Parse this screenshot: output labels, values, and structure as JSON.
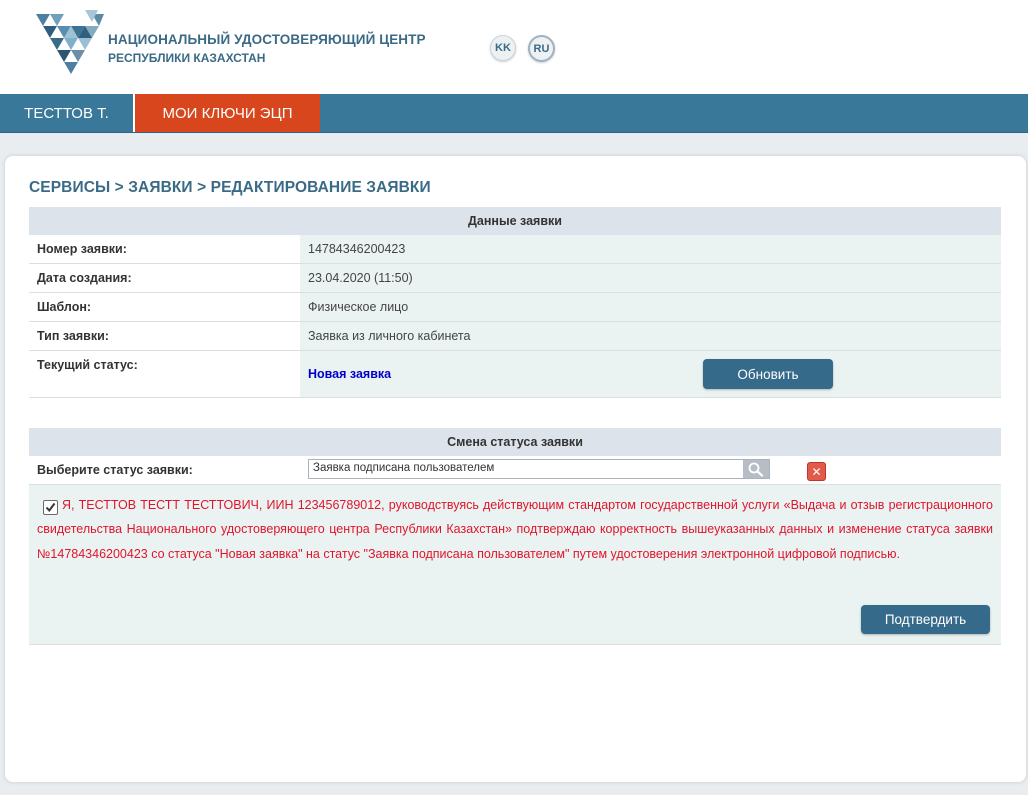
{
  "header": {
    "org_name": "НАЦИОНАЛЬНЫЙ УДОСТОВЕРЯЮЩИЙ ЦЕНТР",
    "org_sub": "РЕСПУБЛИКИ КАЗАХСТАН",
    "lang_kk": "KK",
    "lang_ru": "RU",
    "brand_color": "#3b6a86"
  },
  "nav": {
    "user_label": "ТЕСТТОВ Т.",
    "keys_label": "МОИ КЛЮЧИ ЭЦП",
    "bar_color": "#3a7899",
    "active_color": "#d8461e"
  },
  "breadcrumb": "СЕРВИСЫ > ЗАЯВКИ > РЕДАКТИРОВАНИЕ ЗАЯВКИ",
  "request_data": {
    "heading": "Данные заявки",
    "rows": [
      {
        "label": "Номер заявки:",
        "value": "14784346200423"
      },
      {
        "label": "Дата создания:",
        "value": "23.04.2020 (11:50)"
      },
      {
        "label": "Шаблон:",
        "value": "Физическое лицо"
      },
      {
        "label": "Тип заявки:",
        "value": "Заявка из личного кабинета"
      },
      {
        "label": "Текущий статус:",
        "value": "Новая заявка"
      }
    ],
    "refresh_button": "Обновить"
  },
  "status_change": {
    "heading": "Смена статуса заявки",
    "select_label": "Выберите статус заявки:",
    "select_value": "Заявка подписана пользователем",
    "consent_checked": true,
    "consent_text": "Я, ТЕСТТОВ ТЕСТТ ТЕСТТОВИЧ, ИИН 123456789012, руководствуясь действующим стандартом государственной услуги «Выдача и отзыв регистрационного свидетельства Национального удостоверяющего центра Республики Казахстан» подтверждаю корректность вышеуказанных данных и изменение статуса заявки №14784346200423 со статуса \"Новая заявка\" на статус \"Заявка подписана пользователем\" путем удостоверения электронной цифровой подписью.",
    "confirm_button": "Подтвердить"
  },
  "icons": [
    "logo-icon",
    "search-icon",
    "close-icon",
    "check-icon"
  ]
}
